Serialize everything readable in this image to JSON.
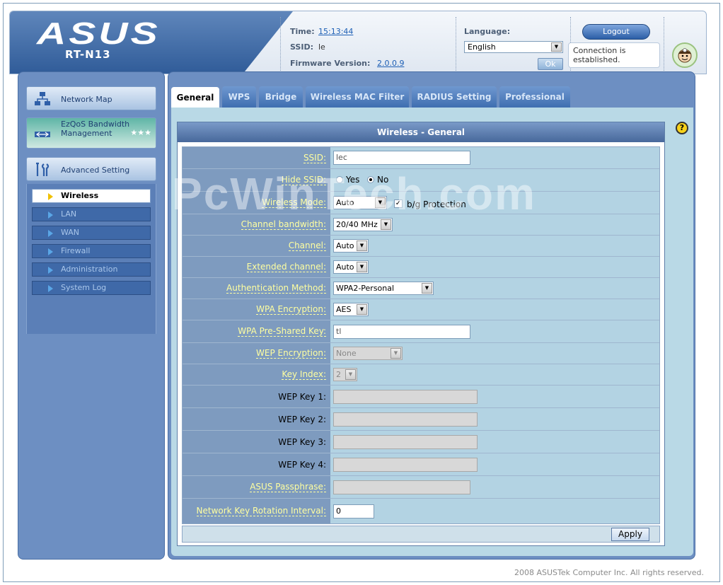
{
  "header": {
    "brand": "ASUS",
    "model": "RT-N13",
    "time_label": "Time:",
    "time_value": "15:13:44",
    "ssid_label": "SSID:",
    "ssid_value": "le",
    "firmware_label": "Firmware Version:",
    "firmware_value": "2.0.0.9",
    "language_label": "Language:",
    "language_value": "English",
    "ok_label": "Ok",
    "logout_label": "Logout",
    "connection_status": "Connection is established."
  },
  "sidebar": {
    "items": [
      {
        "label": "Network Map"
      },
      {
        "label": "EzQoS Bandwidth Management"
      },
      {
        "label": "Advanced Setting"
      }
    ],
    "subitems": [
      {
        "label": "Wireless"
      },
      {
        "label": "LAN"
      },
      {
        "label": "WAN"
      },
      {
        "label": "Firewall"
      },
      {
        "label": "Administration"
      },
      {
        "label": "System Log"
      }
    ]
  },
  "tabs": [
    {
      "label": "General"
    },
    {
      "label": "WPS"
    },
    {
      "label": "Bridge"
    },
    {
      "label": "Wireless MAC Filter"
    },
    {
      "label": "RADIUS Setting"
    },
    {
      "label": "Professional"
    }
  ],
  "panel": {
    "title": "Wireless - General",
    "help": "?",
    "fields": {
      "ssid_label": "SSID:",
      "ssid_value": "lec",
      "hide_ssid_label": "Hide SSID:",
      "hide_yes": "Yes",
      "hide_no": "No",
      "wireless_mode_label": "Wireless Mode:",
      "wireless_mode_value": "Auto",
      "bg_protection_label": "b/g Protection",
      "channel_bandwidth_label": "Channel bandwidth:",
      "channel_bandwidth_value": "20/40 MHz",
      "channel_label": "Channel:",
      "channel_value": "Auto",
      "extended_channel_label": "Extended channel:",
      "extended_channel_value": "Auto",
      "auth_method_label": "Authentication Method:",
      "auth_method_value": "WPA2-Personal",
      "wpa_encryption_label": "WPA Encryption:",
      "wpa_encryption_value": "AES",
      "wpa_psk_label": "WPA Pre-Shared Key:",
      "wpa_psk_value": "tl",
      "wep_encryption_label": "WEP Encryption:",
      "wep_encryption_value": "None",
      "key_index_label": "Key Index:",
      "key_index_value": "2",
      "wep_key1_label": "WEP Key 1:",
      "wep_key2_label": "WEP Key 2:",
      "wep_key3_label": "WEP Key 3:",
      "wep_key4_label": "WEP Key 4:",
      "asus_passphrase_label": "ASUS Passphrase:",
      "key_rotation_label": "Network Key Rotation Interval:",
      "key_rotation_value": "0"
    },
    "apply_label": "Apply"
  },
  "footer": {
    "copyright": "2008 ASUSTek Computer Inc. All rights reserved."
  },
  "watermark": "PcWinTech.com"
}
